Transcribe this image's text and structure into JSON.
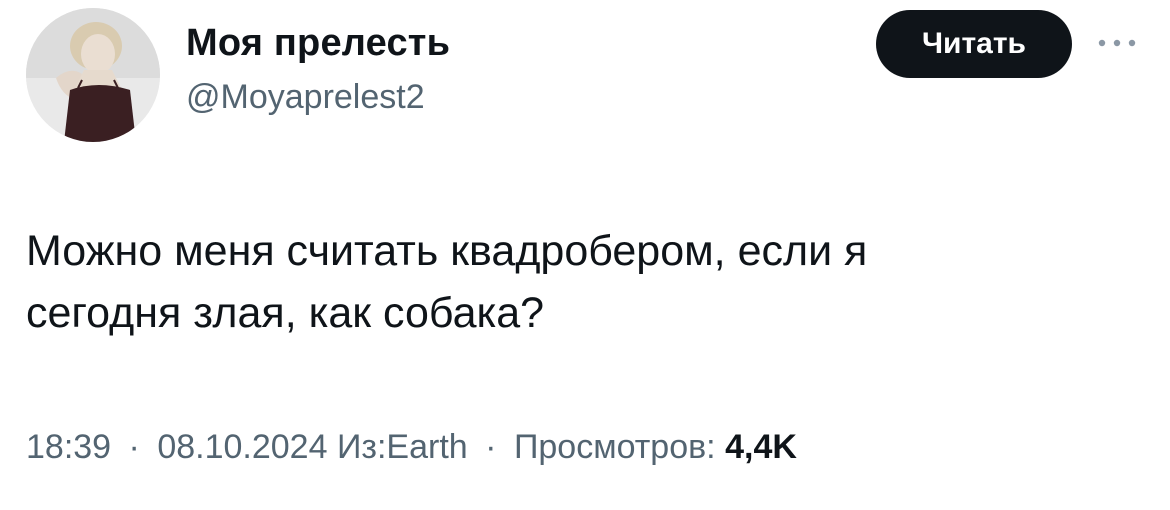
{
  "author": {
    "display_name": "Моя прелесть",
    "handle": "@Moyaprelest2"
  },
  "follow_button": {
    "label": "Читать"
  },
  "more_button": {
    "icon": "more-horizontal-icon"
  },
  "tweet": {
    "text": "Можно меня считать квадробером, если я\nсегодня злая, как собака?"
  },
  "meta": {
    "time": "18:39",
    "date": "08.10.2024",
    "source": "Из:Earth",
    "views_label": "Просмотров:",
    "views_count": "4,4K",
    "separator": "·"
  },
  "colors": {
    "text_primary": "#0f1419",
    "text_secondary": "#536471",
    "button_bg": "#0f1419",
    "button_text": "#ffffff",
    "background": "#ffffff"
  }
}
